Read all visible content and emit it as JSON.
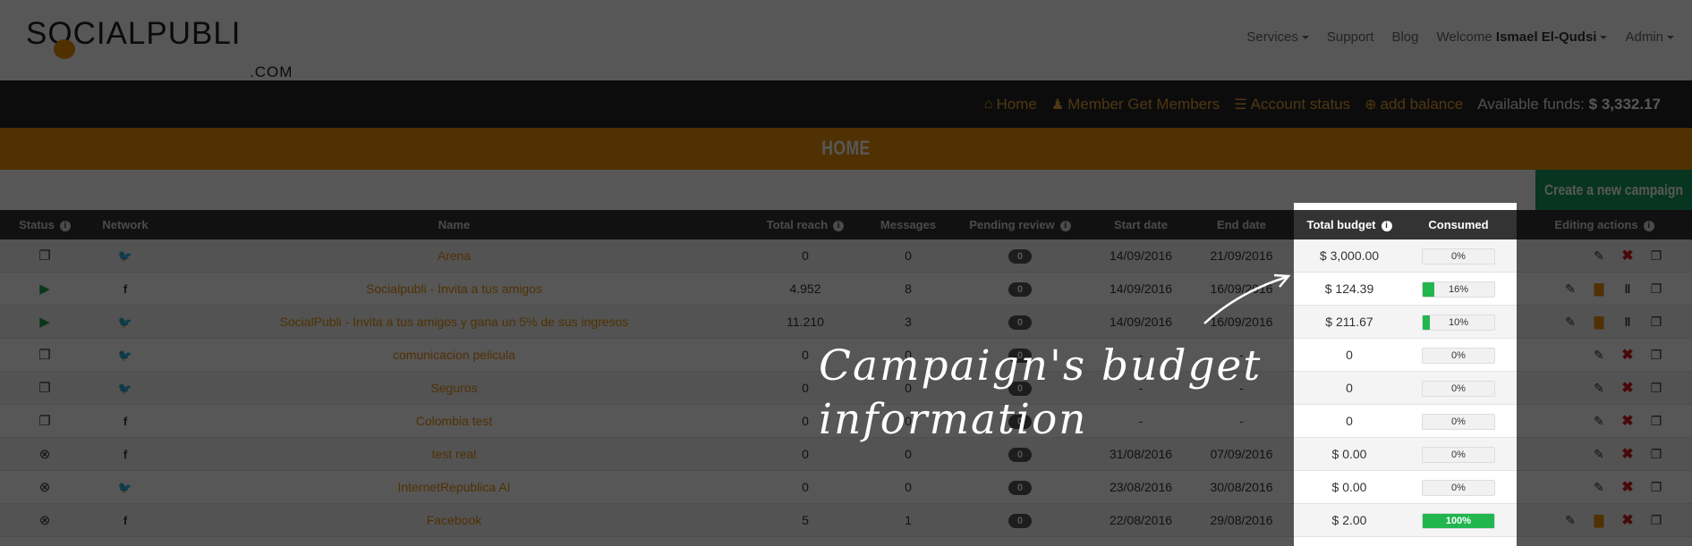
{
  "header": {
    "logo_text": "SOCIALPUBLI",
    "logo_suffix": ".COM",
    "nav": {
      "services": "Services",
      "support": "Support",
      "blog": "Blog",
      "welcome_prefix": "Welcome",
      "user_name": "Ismael El-Qudsi",
      "admin": "Admin"
    }
  },
  "subnav": {
    "home": "Home",
    "member_get_members": "Member Get Members",
    "account_status": "Account status",
    "add_balance": "add balance",
    "funds_label": "Available funds:",
    "funds_value": "$ 3,332.17",
    "icons": {
      "home": "home-icon",
      "member": "user-icon",
      "account": "list-icon",
      "balance": "plus-circle-icon"
    }
  },
  "banner": {
    "title": "HOME"
  },
  "create_button": "Create a new campaign",
  "table": {
    "columns": {
      "status": "Status",
      "network": "Network",
      "name": "Name",
      "total_reach": "Total reach",
      "messages": "Messages",
      "pending_review": "Pending review",
      "start_date": "Start date",
      "end_date": "End date",
      "total_budget": "Total budget",
      "consumed": "Consumed",
      "editing_actions": "Editing actions"
    },
    "rows": [
      {
        "status": "inbox",
        "network": "twitter",
        "name": "Arena",
        "reach": "0",
        "messages": "0",
        "pending": "0",
        "start": "14/09/2016",
        "end": "21/09/2016",
        "budget": "$ 3,000.00",
        "consumed": "0%",
        "consumed_value": 0,
        "actions": [
          "edit",
          "delete",
          "copy"
        ]
      },
      {
        "status": "play",
        "network": "facebook",
        "name": "Socialpubli - Invita a tus amigos",
        "reach": "4.952",
        "messages": "8",
        "pending": "0",
        "start": "14/09/2016",
        "end": "16/09/2016",
        "budget": "$ 124.39",
        "consumed": "16%",
        "consumed_value": 16,
        "actions": [
          "edit",
          "stats",
          "pause",
          "copy"
        ]
      },
      {
        "status": "play",
        "network": "twitter",
        "name": "SocialPubli - Invita a tus amigos y gana un 5% de sus ingresos",
        "reach": "11.210",
        "messages": "3",
        "pending": "0",
        "start": "14/09/2016",
        "end": "16/09/2016",
        "budget": "$ 211.67",
        "consumed": "10%",
        "consumed_value": 10,
        "actions": [
          "edit",
          "stats",
          "pause",
          "copy"
        ]
      },
      {
        "status": "inbox",
        "network": "twitter",
        "name": "comunicacion pelicula",
        "reach": "0",
        "messages": "0",
        "pending": "0",
        "start": "-",
        "end": "-",
        "budget": "0",
        "consumed": "0%",
        "consumed_value": 0,
        "actions": [
          "edit",
          "delete",
          "copy"
        ]
      },
      {
        "status": "inbox",
        "network": "twitter",
        "name": "Seguros",
        "reach": "0",
        "messages": "0",
        "pending": "0",
        "start": "-",
        "end": "-",
        "budget": "0",
        "consumed": "0%",
        "consumed_value": 0,
        "actions": [
          "edit",
          "delete",
          "copy"
        ]
      },
      {
        "status": "inbox",
        "network": "facebook",
        "name": "Colombia test",
        "reach": "0",
        "messages": "0",
        "pending": "0",
        "start": "-",
        "end": "-",
        "budget": "0",
        "consumed": "0%",
        "consumed_value": 0,
        "actions": [
          "edit",
          "delete",
          "copy"
        ]
      },
      {
        "status": "cancelled",
        "network": "facebook",
        "name": "test real",
        "reach": "0",
        "messages": "0",
        "pending": "0",
        "start": "31/08/2016",
        "end": "07/09/2016",
        "budget": "$ 0.00",
        "consumed": "0%",
        "consumed_value": 0,
        "actions": [
          "edit",
          "delete",
          "copy"
        ]
      },
      {
        "status": "cancelled",
        "network": "twitter",
        "name": "InternetRepublica AI",
        "reach": "0",
        "messages": "0",
        "pending": "0",
        "start": "23/08/2016",
        "end": "30/08/2016",
        "budget": "$ 0.00",
        "consumed": "0%",
        "consumed_value": 0,
        "actions": [
          "edit",
          "delete",
          "copy"
        ]
      },
      {
        "status": "cancelled",
        "network": "facebook",
        "name": "Facebook",
        "reach": "5",
        "messages": "1",
        "pending": "0",
        "start": "22/08/2016",
        "end": "29/08/2016",
        "budget": "$ 2.00",
        "consumed": "100%",
        "consumed_value": 100,
        "actions": [
          "edit",
          "stats",
          "delete",
          "copy"
        ]
      }
    ]
  },
  "annotation": {
    "line1": "Campaign's budget",
    "line2": "information"
  },
  "colors": {
    "accent": "#e88f0a",
    "dark": "#232323",
    "green": "#1a9b5c",
    "progress": "#22b64f",
    "delete": "#d31c1c"
  }
}
